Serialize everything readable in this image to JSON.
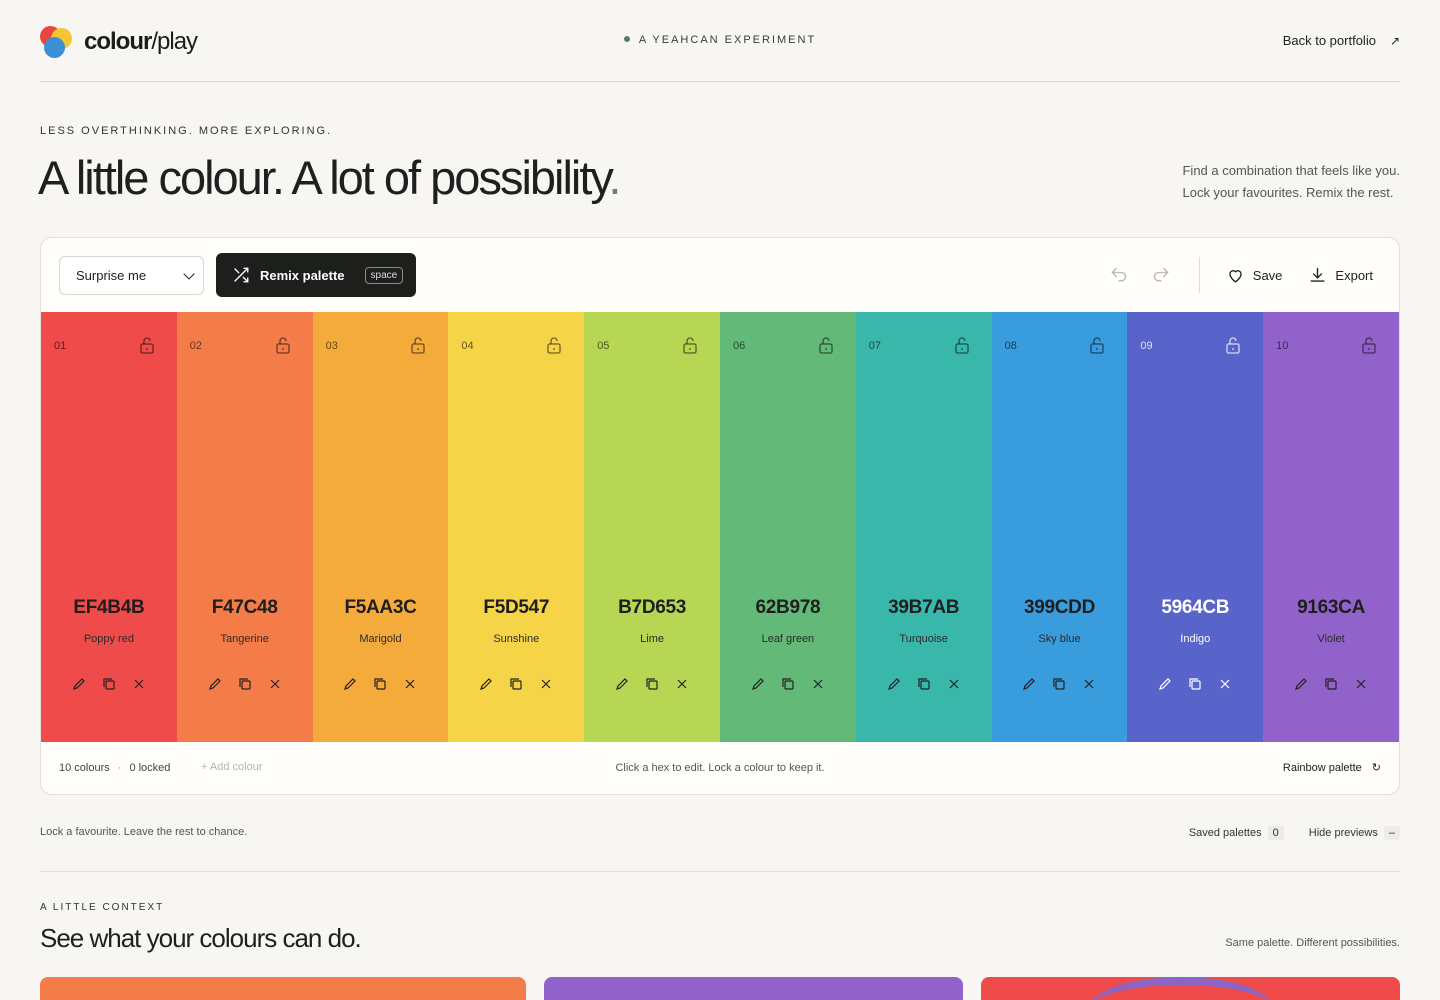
{
  "header": {
    "logo_bold": "colour",
    "logo_thin": "/play",
    "tagline": "A YEAHCAN EXPERIMENT",
    "back_link": "Back to portfolio",
    "back_icon": "arrow-up-right-icon"
  },
  "hero": {
    "eyebrow": "LESS OVERTHINKING. MORE EXPLORING.",
    "title": "A little colour. A lot of possibility",
    "title_accent": ".",
    "side_line1": "Find a combination that feels like you.",
    "side_line2": "Lock your favourites. Remix the rest."
  },
  "toolbar": {
    "mode_select": "Surprise me",
    "remix_label": "Remix palette",
    "remix_shortcut": "space",
    "save_label": "Save",
    "export_label": "Export"
  },
  "swatches": [
    {
      "num": "01",
      "hex": "EF4B4B",
      "name": "Poppy red",
      "color": "#EF4B4B"
    },
    {
      "num": "02",
      "hex": "F47C48",
      "name": "Tangerine",
      "color": "#F47C48"
    },
    {
      "num": "03",
      "hex": "F5AA3C",
      "name": "Marigold",
      "color": "#F5AA3C"
    },
    {
      "num": "04",
      "hex": "F5D547",
      "name": "Sunshine",
      "color": "#F5D547"
    },
    {
      "num": "05",
      "hex": "B7D653",
      "name": "Lime",
      "color": "#B7D653"
    },
    {
      "num": "06",
      "hex": "62B978",
      "name": "Leaf green",
      "color": "#62B978"
    },
    {
      "num": "07",
      "hex": "39B7AB",
      "name": "Turquoise",
      "color": "#39B7AB"
    },
    {
      "num": "08",
      "hex": "399CDD",
      "name": "Sky blue",
      "color": "#399CDD"
    },
    {
      "num": "09",
      "hex": "5964CB",
      "name": "Indigo",
      "color": "#5964CB"
    },
    {
      "num": "10",
      "hex": "9163CA",
      "name": "Violet",
      "color": "#9163CA"
    }
  ],
  "panel_footer": {
    "count": "10 colours",
    "locked": "0 locked",
    "add_colour": "Add colour",
    "hint": "Click a hex to edit. Lock a colour to keep it.",
    "palette_name": "Rainbow palette"
  },
  "below": {
    "left_text": "Lock a favourite. Leave the rest to chance.",
    "saved_label": "Saved palettes",
    "saved_count": "0",
    "hide_label": "Hide previews",
    "hide_badge": "–"
  },
  "context": {
    "eyebrow": "A LITTLE CONTEXT",
    "title": "See what your colours can do.",
    "side": "Same palette. Different possibilities."
  }
}
